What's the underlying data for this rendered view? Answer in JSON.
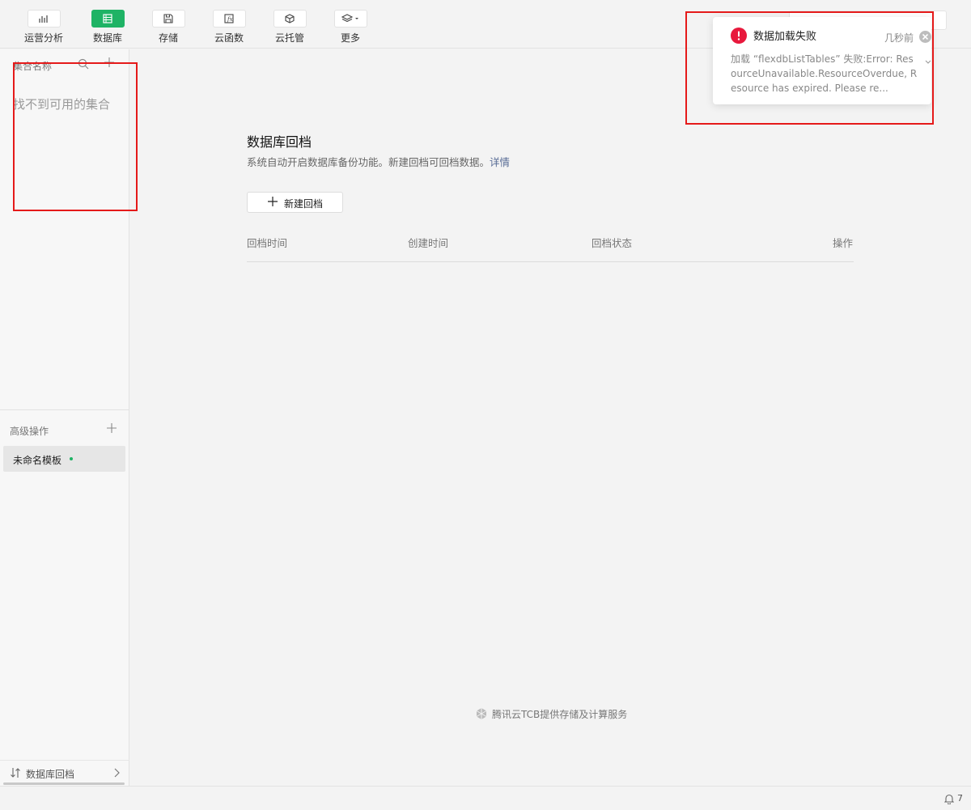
{
  "toolbar": {
    "items": [
      {
        "label": "运营分析",
        "icon": "bar-chart-icon"
      },
      {
        "label": "数据库",
        "icon": "table-icon",
        "active": true
      },
      {
        "label": "存储",
        "icon": "save-icon"
      },
      {
        "label": "云函数",
        "icon": "function-icon"
      },
      {
        "label": "云托管",
        "icon": "cube-icon"
      },
      {
        "label": "更多",
        "icon": "layers-icon"
      }
    ]
  },
  "sidebar": {
    "collections_header": "集合名称",
    "empty_message": "找不到可用的集合",
    "advanced_title": "高级操作",
    "templates": [
      {
        "label": "未命名模板"
      }
    ],
    "bottom_link": "数据库回档"
  },
  "main": {
    "title": "数据库回档",
    "description": "系统自动开启数据库备份功能。新建回档可回档数据。",
    "details_link": "详情",
    "new_button": "新建回档",
    "columns": [
      "回档时间",
      "创建时间",
      "回档状态",
      "操作"
    ],
    "footer": "腾讯云TCB提供存储及计算服务"
  },
  "notification": {
    "title": "数据加载失败",
    "time": "几秒前",
    "message": "加载 “flexdbListTables” 失败:Error: ResourceUnavailable.ResourceOverdue, Resource has expired. Please re..."
  },
  "statusbar": {
    "notification_count": "7"
  },
  "colors": {
    "accent": "#1fb365",
    "error": "#e8183c",
    "highlight": "#e51a1a",
    "link": "#576b95"
  }
}
